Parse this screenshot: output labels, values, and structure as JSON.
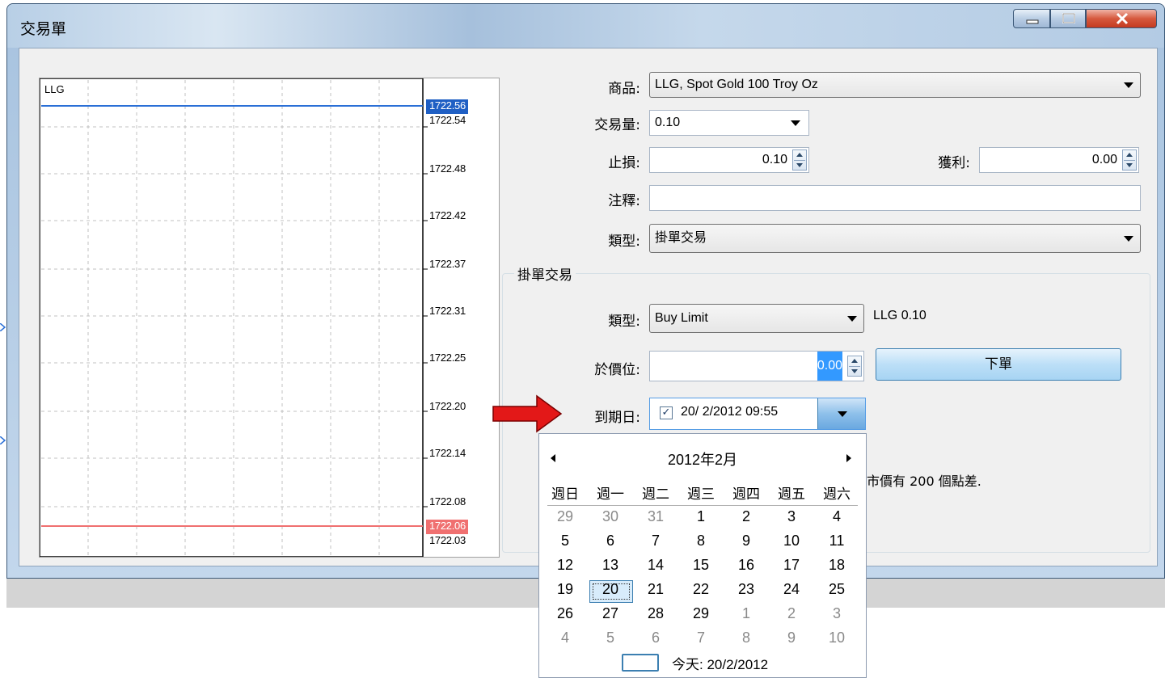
{
  "window": {
    "title": "交易單"
  },
  "chart": {
    "symbol": "LLG",
    "ticks": [
      "1722.56",
      "1722.54",
      "1722.48",
      "1722.42",
      "1722.37",
      "1722.31",
      "1722.25",
      "1722.20",
      "1722.14",
      "1722.08",
      "1722.06",
      "1722.03"
    ],
    "ask_price": "1722.56",
    "bid_price": "1722.06",
    "ask_color": "#2a6fd6",
    "bid_color": "#f07070"
  },
  "form": {
    "symbol_label": "商品:",
    "symbol_value": "LLG, Spot Gold 100 Troy Oz",
    "volume_label": "交易量:",
    "volume_value": "0.10",
    "sl_label": "止損:",
    "sl_value": "0.10",
    "tp_label": "獲利:",
    "tp_value": "0.00",
    "comment_label": "注釋:",
    "comment_value": "",
    "type_label": "類型:",
    "type_value": "掛單交易"
  },
  "pending": {
    "group_title": "掛單交易",
    "type_label": "類型:",
    "type_value": "Buy Limit",
    "type_info": "LLG 0.10",
    "price_label": "於價位:",
    "price_value": "0.00",
    "order_button": "下單",
    "expiry_label": "到期日:",
    "expiry_checked": "✓",
    "expiry_value": "20/  2/2012 09:55",
    "hint": "市價有 200 個點差."
  },
  "calendar": {
    "month_title": "2012年2月",
    "weekdays": [
      "週日",
      "週一",
      "週二",
      "週三",
      "週四",
      "週五",
      "週六"
    ],
    "weeks": [
      [
        "29",
        "30",
        "31",
        "1",
        "2",
        "3",
        "4"
      ],
      [
        "5",
        "6",
        "7",
        "8",
        "9",
        "10",
        "11"
      ],
      [
        "12",
        "13",
        "14",
        "15",
        "16",
        "17",
        "18"
      ],
      [
        "19",
        "20",
        "21",
        "22",
        "23",
        "24",
        "25"
      ],
      [
        "26",
        "27",
        "28",
        "29",
        "1",
        "2",
        "3"
      ],
      [
        "4",
        "5",
        "6",
        "7",
        "8",
        "9",
        "10"
      ]
    ],
    "selected_day": "20",
    "today_label": "今天: 20/2/2012"
  }
}
